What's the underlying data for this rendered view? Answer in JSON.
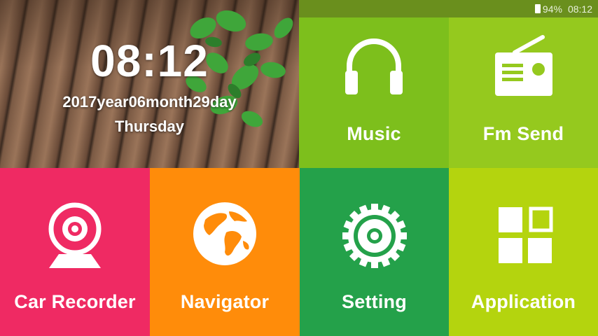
{
  "status_bar": {
    "battery": "94%",
    "time": "08:12"
  },
  "clock": {
    "time": "08:12",
    "date": "2017year06month29day",
    "weekday": "Thursday"
  },
  "tiles": [
    {
      "label": "Music",
      "icon": "headphones-icon",
      "color": "#7dbf1c"
    },
    {
      "label": "Fm Send",
      "icon": "radio-icon",
      "color": "#95c91e"
    },
    {
      "label": "Car Recorder",
      "icon": "webcam-icon",
      "color": "#ef2a63"
    },
    {
      "label": "Navigator",
      "icon": "globe-icon",
      "color": "#ff8c0a"
    },
    {
      "label": "Setting",
      "icon": "gear-icon",
      "color": "#24a14a"
    },
    {
      "label": "Application",
      "icon": "apps-grid-icon",
      "color": "#b4d40e"
    }
  ]
}
